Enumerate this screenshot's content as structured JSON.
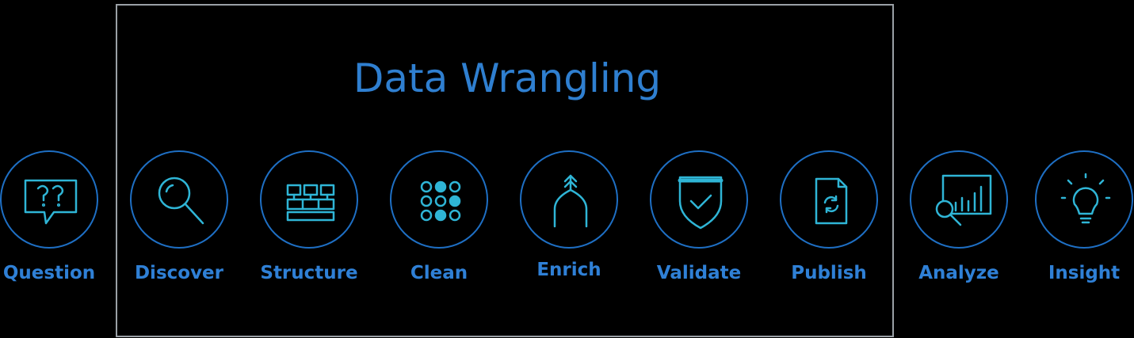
{
  "title": "Data Wrangling",
  "steps": [
    {
      "label": "Question",
      "icon": "speech-bubble-question-icon"
    },
    {
      "label": "Discover",
      "icon": "magnifier-icon"
    },
    {
      "label": "Structure",
      "icon": "structure-blocks-icon"
    },
    {
      "label": "Clean",
      "icon": "dot-grid-icon"
    },
    {
      "label": "Enrich",
      "icon": "arch-arrows-icon"
    },
    {
      "label": "Validate",
      "icon": "shield-check-icon"
    },
    {
      "label": "Publish",
      "icon": "document-refresh-icon"
    },
    {
      "label": "Analyze",
      "icon": "chart-magnifier-icon"
    },
    {
      "label": "Insight",
      "icon": "lightbulb-icon"
    }
  ],
  "colors": {
    "background": "#000000",
    "frame": "#9aa0a6",
    "title": "#2f7fd0",
    "label": "#2f80d6",
    "ring": "#1e6fc4",
    "icon": "#2fb5d6"
  }
}
